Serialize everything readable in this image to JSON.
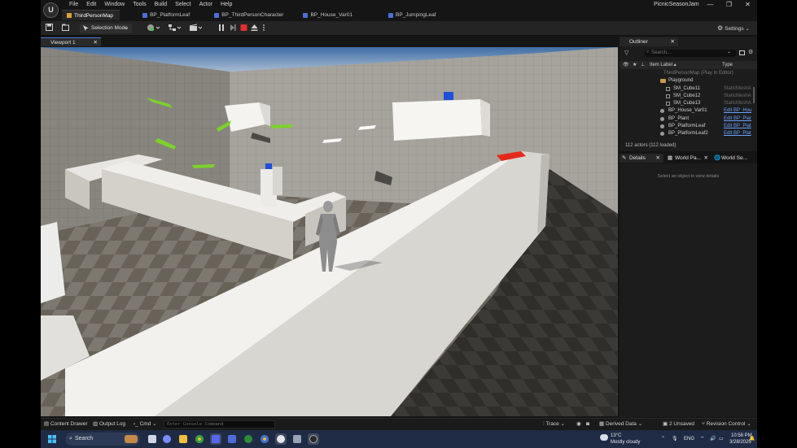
{
  "title_bar": {
    "menu": [
      "File",
      "Edit",
      "Window",
      "Tools",
      "Build",
      "Select",
      "Actor",
      "Help"
    ],
    "project_name": "PicnicSeasonJam",
    "window_controls": [
      "—",
      "❐",
      "✕"
    ]
  },
  "tabs": [
    {
      "label": "ThirdPersonMap",
      "icon": "map-icon",
      "active": true
    },
    {
      "label": "BP_PlatformLeaf",
      "icon": "blueprint-icon"
    },
    {
      "label": "BP_ThirdPersonCharacter",
      "icon": "blueprint-icon"
    },
    {
      "label": "BP_House_Var01",
      "icon": "blueprint-icon"
    },
    {
      "label": "BP_JumpingLeaf",
      "icon": "blueprint-icon"
    }
  ],
  "toolbar": {
    "selection_mode": "Selection Mode",
    "settings": "Settings"
  },
  "viewport": {
    "tab_label": "Viewport 1",
    "close": "✕"
  },
  "outliner": {
    "tab_label": "Outliner",
    "close": "✕",
    "search_placeholder": "Search...",
    "col_label": "Item Label ▴",
    "col_type": "Type",
    "rows": [
      {
        "label": "ThirdPersonMap (Play In Editor)",
        "type": "",
        "dim": true
      },
      {
        "label": "Playground",
        "type": ""
      },
      {
        "label": "SM_Cube11",
        "type": "StaticMeshA"
      },
      {
        "label": "SM_Cube12",
        "type": "StaticMeshA"
      },
      {
        "label": "SM_Cube13",
        "type": "StaticMeshA"
      },
      {
        "label": "BP_House_Var01",
        "type": "Edit BP_Hou",
        "link": true
      },
      {
        "label": "BP_Plant",
        "type": "Edit BP_Plan",
        "link": true
      },
      {
        "label": "BP_PlatformLeaf",
        "type": "Edit BP_Plat",
        "link": true
      },
      {
        "label": "BP_PlatformLeaf2",
        "type": "Edit BP_Plat",
        "link": true
      }
    ],
    "status": "112 actors (112 loaded)"
  },
  "details": {
    "tabs": [
      {
        "label": "Details",
        "close": "✕"
      },
      {
        "label": "World Pa...",
        "close": "✕"
      },
      {
        "label": "World Se...",
        "close": ""
      }
    ],
    "empty_text": "Select an object to view details"
  },
  "status_bar": {
    "content_drawer": "Content Drawer",
    "output_log": "Output Log",
    "cmd": "Cmd",
    "console_placeholder": "Enter Console Command",
    "trace": "Trace",
    "derived_data": "Derived Data",
    "unsaved": "2 Unsaved",
    "revision_control": "Revision Control"
  },
  "taskbar": {
    "search": "Search",
    "weather_temp": "13°C",
    "weather_desc": "Mostly cloudy",
    "lang": "ENG",
    "time": "10:58 PM",
    "date": "3/28/2025"
  },
  "colors": {
    "accent": "#4a7bd0",
    "link": "#6aa0ff",
    "play_stop": "#e03030",
    "leaf_green": "#7cd22a"
  }
}
